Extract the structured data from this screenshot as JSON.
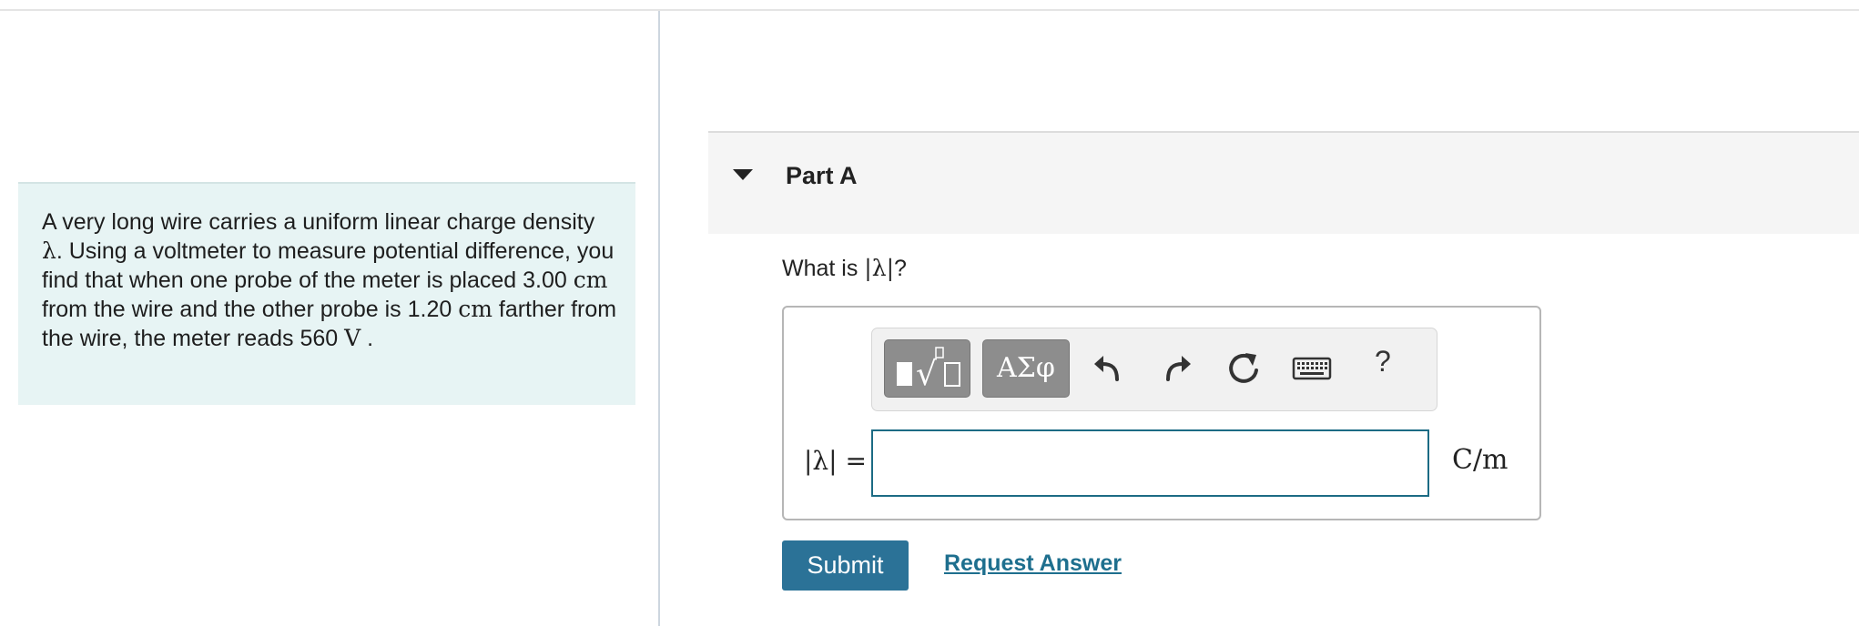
{
  "problem": {
    "segments": [
      {
        "t": "A very long wire carries a uniform linear charge density ",
        "m": false
      },
      {
        "t": "λ",
        "m": true
      },
      {
        "t": ". Using a voltmeter to measure potential difference, you find that when one probe of the meter is placed 3.00 ",
        "m": false
      },
      {
        "t": "cm",
        "m": true
      },
      {
        "t": " from the wire and the other probe is 1.20 ",
        "m": false
      },
      {
        "t": "cm",
        "m": true
      },
      {
        "t": " farther from the wire, the meter reads 560 ",
        "m": false
      },
      {
        "t": "V",
        "m": true
      },
      {
        "t": " .",
        "m": false
      }
    ]
  },
  "part": {
    "title": "Part A",
    "question_prefix": "What is ",
    "question_math": "|λ|",
    "question_suffix": "?"
  },
  "toolbar": {
    "greek_label": "ΑΣφ",
    "help_label": "?",
    "icons": [
      "templates-icon",
      "greek-symbols-icon",
      "undo-icon",
      "redo-icon",
      "reset-icon",
      "keyboard-icon",
      "help-icon"
    ]
  },
  "answer": {
    "label": "|λ| =",
    "value": "",
    "placeholder": "",
    "unit": "C/m"
  },
  "actions": {
    "submit_label": "Submit",
    "request_label": "Request Answer"
  },
  "colors": {
    "problem_bg": "#e7f4f4",
    "submit_bg": "#2b7297",
    "link": "#1e6f8e",
    "input_border": "#1c6b84"
  }
}
